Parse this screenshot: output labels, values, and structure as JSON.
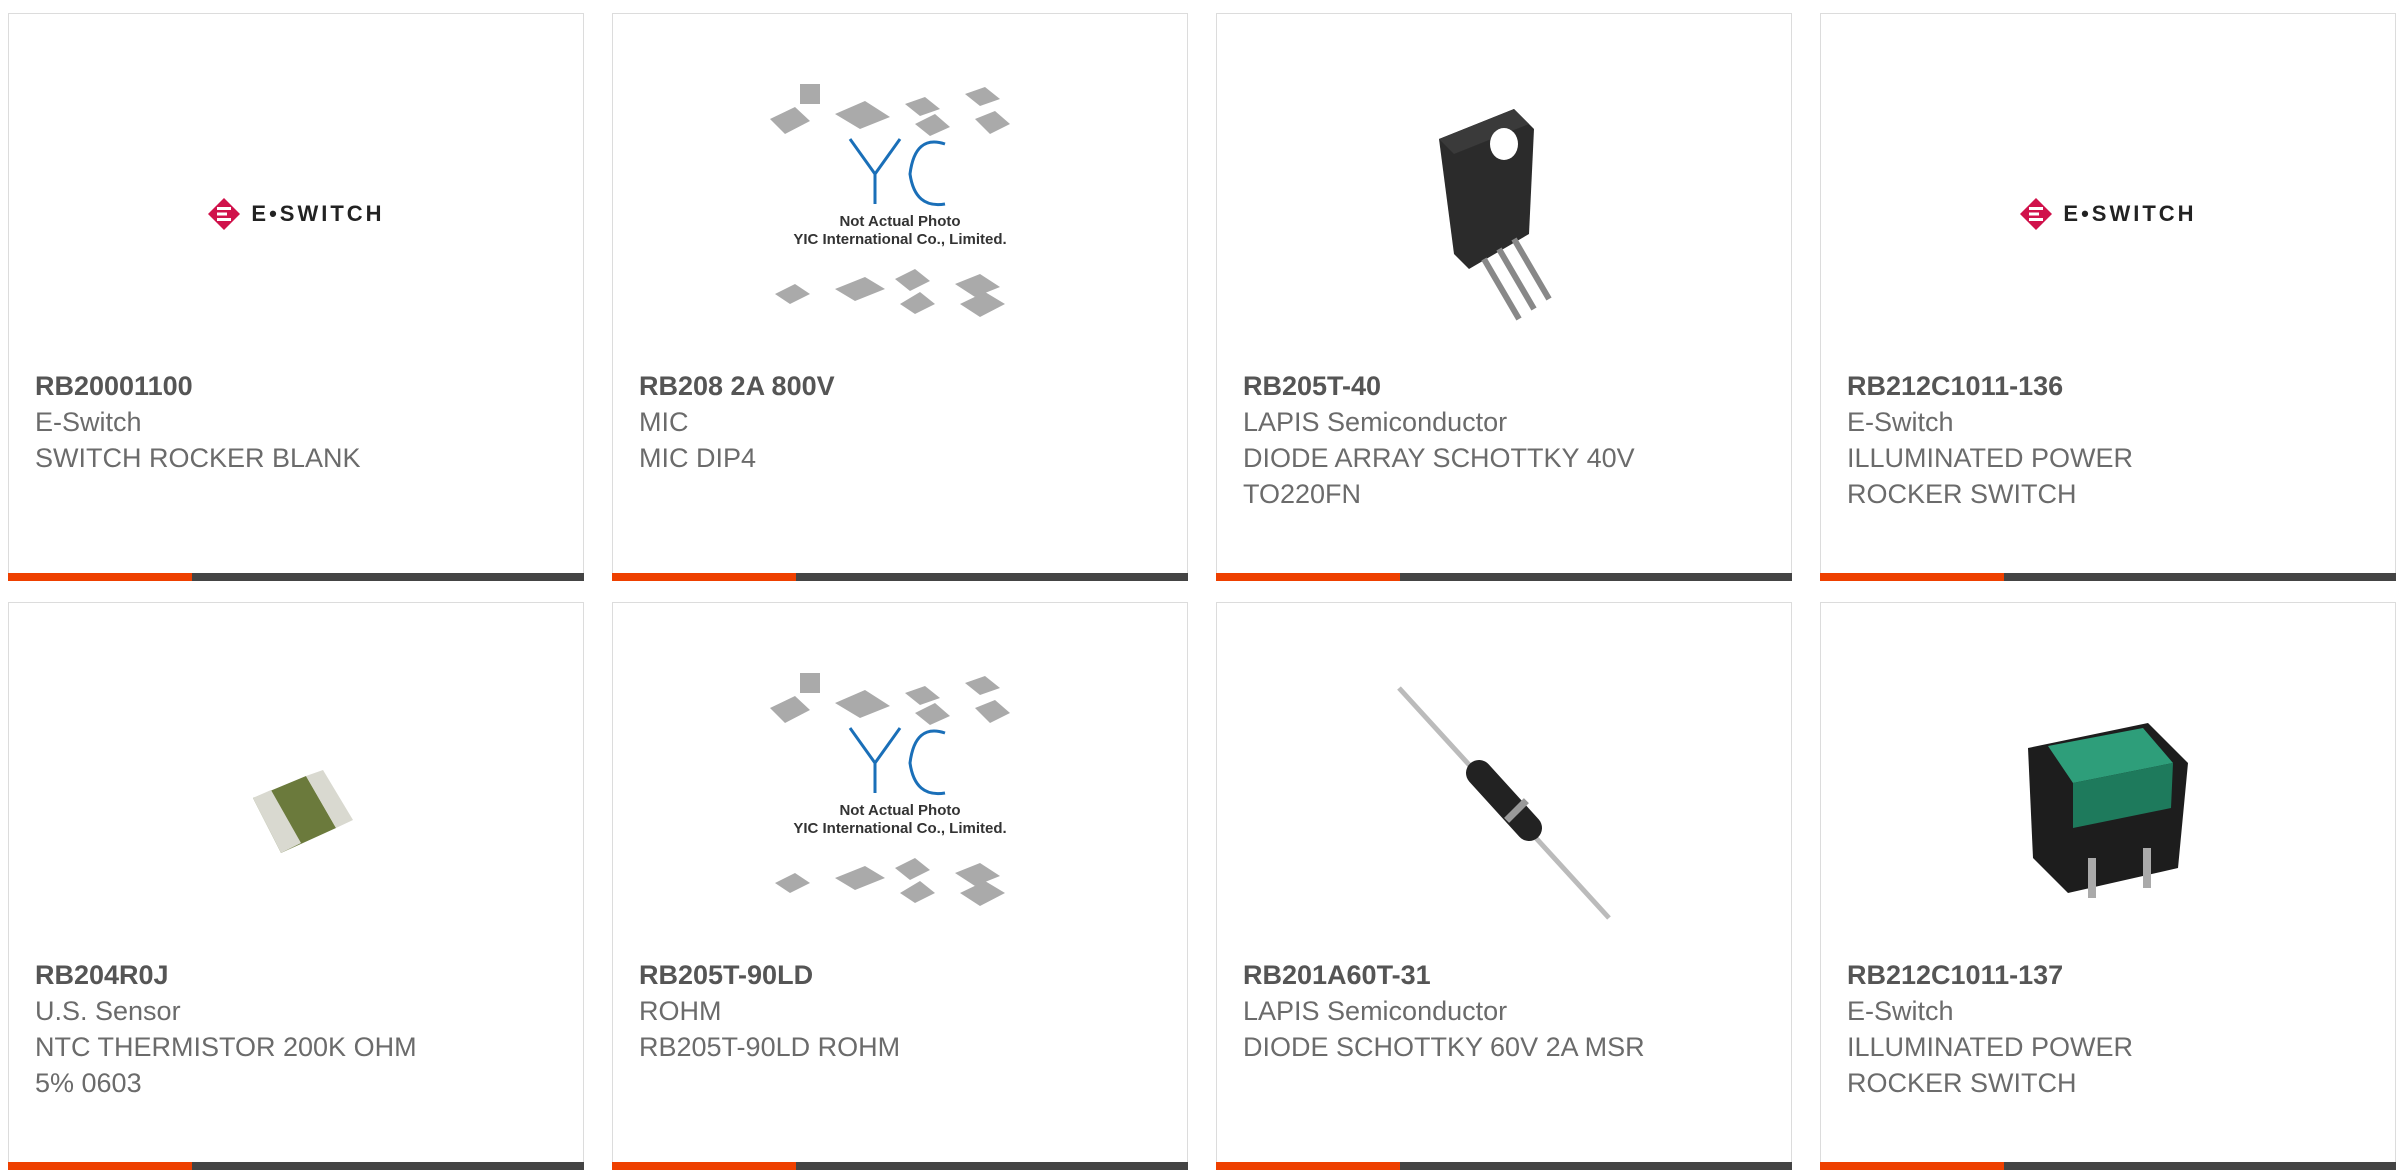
{
  "brand_color": "#ee4000",
  "products": [
    {
      "part_number": "RB20001100",
      "manufacturer": "E-Switch",
      "desc_lines": [
        "SWITCH ROCKER BLANK"
      ],
      "image": "eswitch-logo",
      "logo_text": "E•SWITCH"
    },
    {
      "part_number": "RB208 2A 800V",
      "manufacturer": "MIC",
      "desc_lines": [
        "MIC DIP4"
      ],
      "image": "yic-not-actual-photo",
      "photo_caption_1": "Not Actual Photo",
      "photo_caption_2": "YIC International Co., Limited."
    },
    {
      "part_number": "RB205T-40",
      "manufacturer": "LAPIS Semiconductor",
      "desc_lines": [
        "DIODE ARRAY SCHOTTKY 40V",
        "TO220FN"
      ],
      "image": "to220-package-photo"
    },
    {
      "part_number": "RB212C1011-136",
      "manufacturer": "E-Switch",
      "desc_lines": [
        "ILLUMINATED POWER",
        "ROCKER SWITCH"
      ],
      "image": "eswitch-logo",
      "logo_text": "E•SWITCH"
    },
    {
      "part_number": "RB204R0J",
      "manufacturer": "U.S. Sensor",
      "desc_lines": [
        "NTC THERMISTOR 200K OHM",
        "5% 0603"
      ],
      "image": "smd-thermistor-photo"
    },
    {
      "part_number": "RB205T-90LD",
      "manufacturer": "ROHM",
      "desc_lines": [
        "RB205T-90LD ROHM"
      ],
      "image": "yic-not-actual-photo",
      "photo_caption_1": "Not Actual Photo",
      "photo_caption_2": "YIC International Co., Limited."
    },
    {
      "part_number": "RB201A60T-31",
      "manufacturer": "LAPIS Semiconductor",
      "desc_lines": [
        "DIODE SCHOTTKY 60V 2A MSR"
      ],
      "image": "axial-diode-photo"
    },
    {
      "part_number": "RB212C1011-137",
      "manufacturer": "E-Switch",
      "desc_lines": [
        "ILLUMINATED POWER",
        "ROCKER SWITCH"
      ],
      "image": "rocker-switch-photo"
    }
  ]
}
